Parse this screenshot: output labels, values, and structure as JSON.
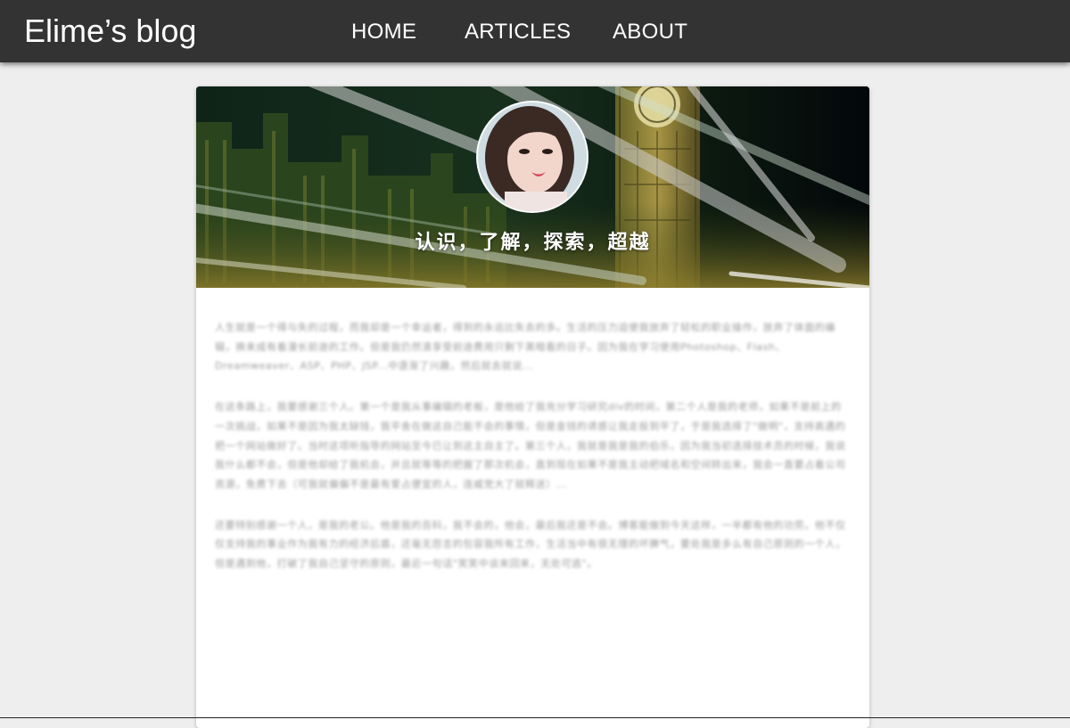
{
  "header": {
    "brand": "Elime’s blog",
    "nav": [
      {
        "label": "HOME"
      },
      {
        "label": "ARTICLES"
      },
      {
        "label": "ABOUT"
      }
    ]
  },
  "profile": {
    "tagline": "认识，了解，探索，超越"
  },
  "article": {
    "paragraphs": [
      "人生就是一个得与失的过程，而我却是一个幸运者，得到的永远比失去的多。生活的压力迫使我放弃了轻松的职业操作，放弃了体面的编辑，换来成有着漫长前途的工作。但是我仍然清享受前途费用只剩下黑暗看的日子。因为我在学习使用Photoshop、Flash、Dreamweaver、ASP、PHP、JSP...中逐渐了兴趣，然后就去就说...",
      "在这条路上，我要感谢三个人。第一个是我从事编辑的老板，是他给了我充分学习研究div的时间，第二个人是我的老师，如果不是前上的一次挑战，如果不是因为我太缺钱，我平舍在做这自己能不会的事情，但是金钱的诱惑让我走投到平了，于是我选择了\"做明\"，支持高遇的把一个网站做好了。当时这项听指导的网站至今已让到这主自主了。第三个人，我就是我是我的伯乐，因为我当初选择技术员的时候，我说我什么都不会，但是他却给了我机会，并且就等等的把握了那次机会，直到现在如果不是我主动把域名和空间转出来，我会一直要占着公司资源，免费下去（可我就偏偏不是最有爱占便宜的人，连威党大了就释送）...",
      "还要特别感谢一个人，是我的老公。他是我的百科，我不会的，他会，最后我还是不会。博客能做到今天这样，一半都有他的功劳。他不仅仅支持我的事业作为我有力的经济后盾，还毫无怨言的包容我所有工作，生活当中有很无理的坏脾气，要处我是多么有自己原则的一个人，但是遇到他，打破了我自己坚守的原则，最近一句话\"笑笑中谈来回来，无处可逃\"。"
    ]
  },
  "colors": {
    "topbar": "#333333",
    "page_bg": "#eeeeee",
    "card_bg": "#ffffff",
    "blurred_text": "#9a9a9a"
  }
}
